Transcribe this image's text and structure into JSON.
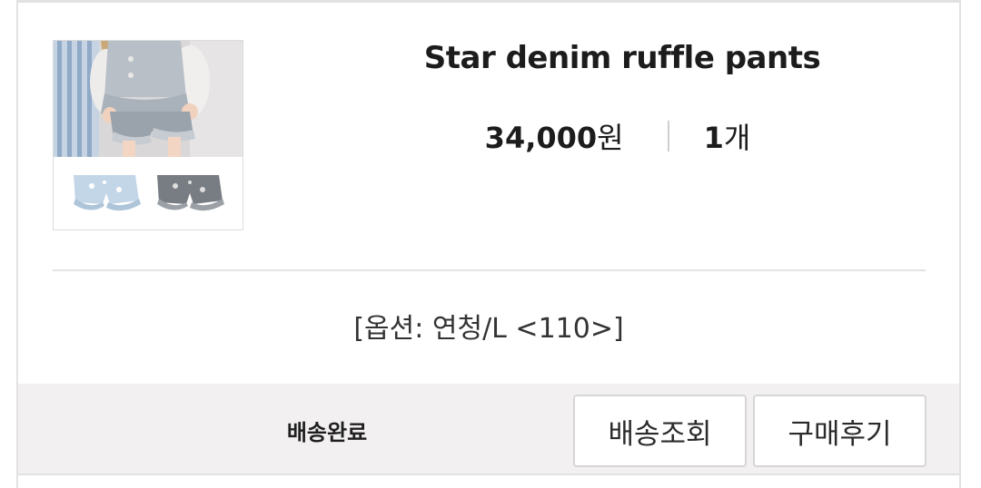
{
  "product": {
    "name": "Star denim ruffle pants",
    "price_amount": "34,000",
    "price_unit": "원",
    "quantity_amount": "1",
    "quantity_unit": "개",
    "option_text": "[옵션: 연청/L <110>]"
  },
  "order": {
    "status_label": "배송완료",
    "track_button_label": "배송조회",
    "review_button_label": "구매후기"
  },
  "colors": {
    "footer_background": "#f3f0f1",
    "border": "#e2e2e2"
  }
}
